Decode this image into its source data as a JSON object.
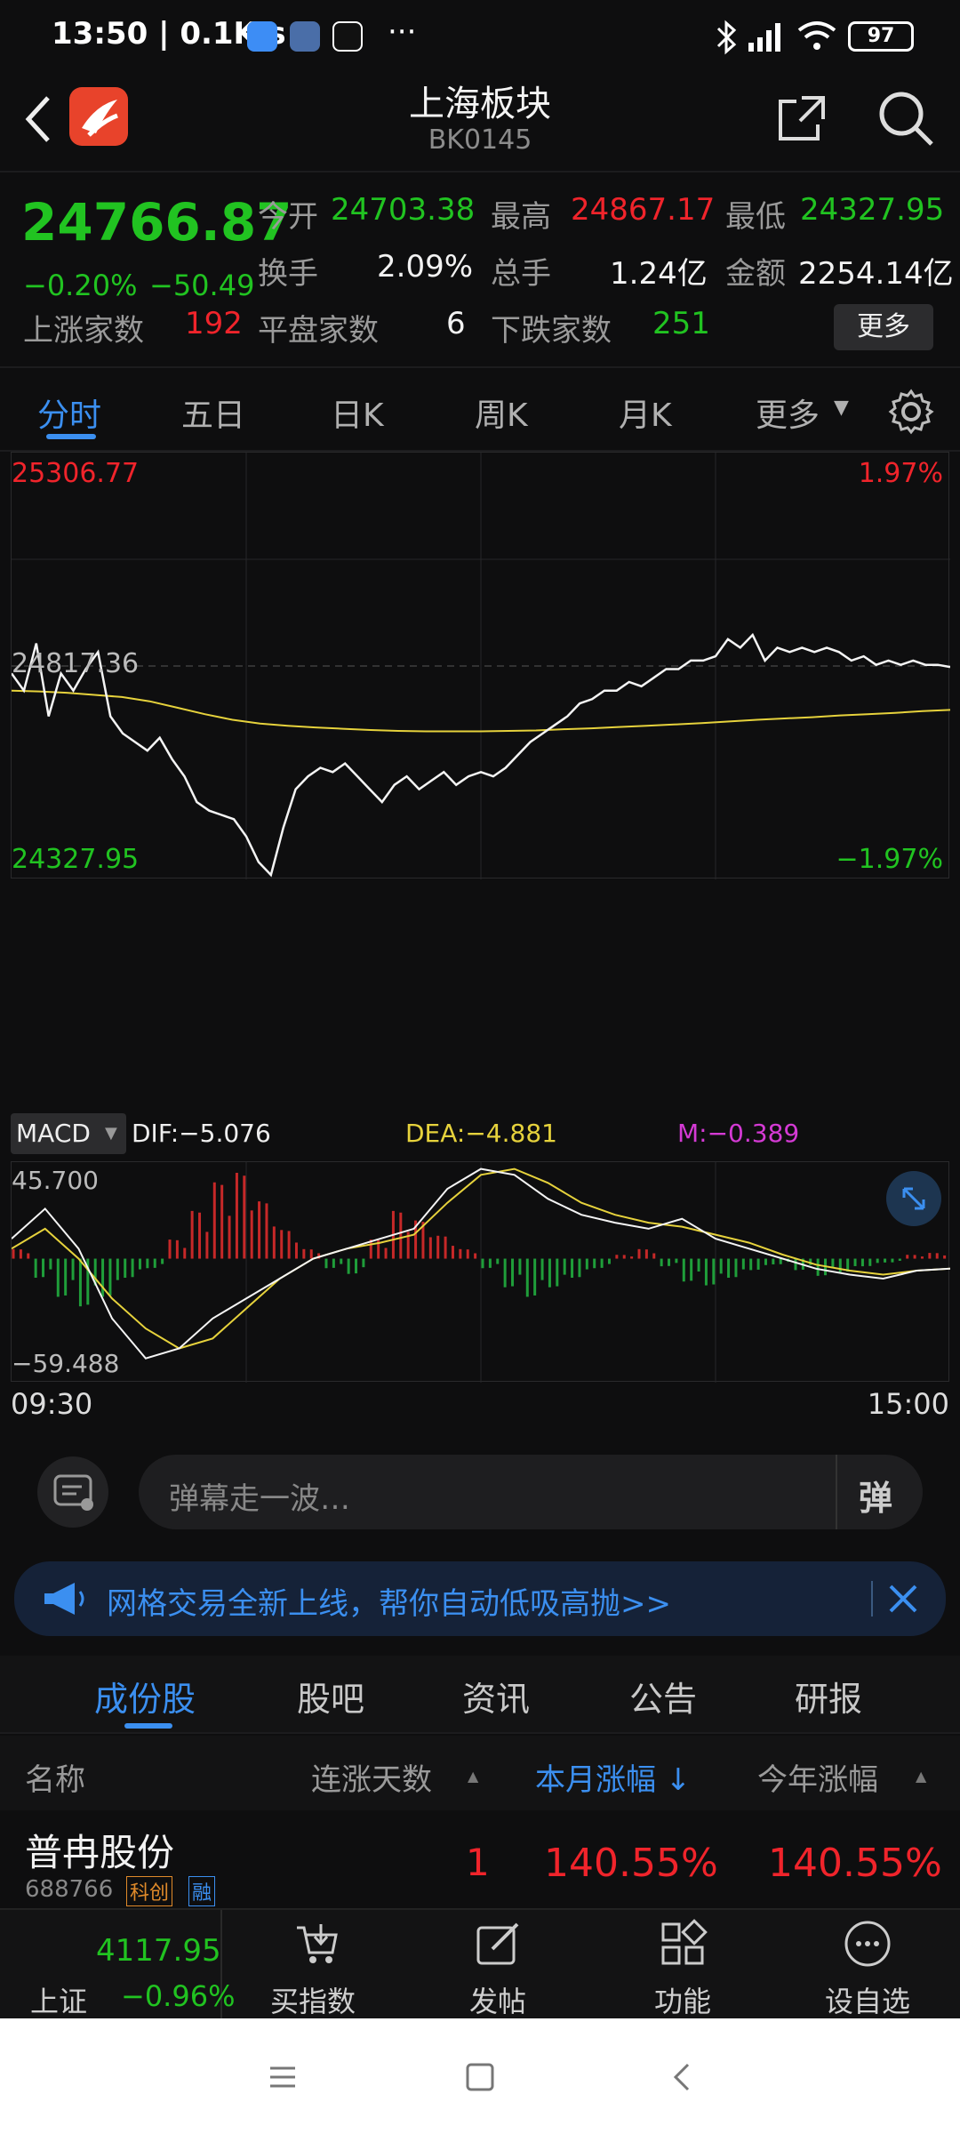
{
  "status_bar": {
    "time": "13:50 | 0.1K/s",
    "more_dots": "···",
    "battery": "97"
  },
  "header": {
    "title": "上海板块",
    "code": "BK0145"
  },
  "quote": {
    "price": "24766.87",
    "change_pct": "−0.20%",
    "change_abs": "−50.49",
    "open_label": "今开",
    "open": "24703.38",
    "high_label": "最高",
    "high": "24867.17",
    "low_label": "最低",
    "low": "24327.95",
    "turnover_label": "换手",
    "turnover": "2.09%",
    "volume_label": "总手",
    "volume": "1.24亿",
    "amount_label": "金额",
    "amount": "2254.14亿",
    "up_label": "上涨家数",
    "up": "192",
    "flat_label": "平盘家数",
    "flat": "6",
    "down_label": "下跌家数",
    "down": "251",
    "more_button": "更多"
  },
  "chart_tabs": [
    "分时",
    "五日",
    "日K",
    "周K",
    "月K",
    "更多"
  ],
  "chart_data": {
    "type": "line",
    "y_max_label": "25306.77",
    "y_max_pct": "1.97%",
    "y_mid_label": "24817.36",
    "y_min_label": "24327.95",
    "y_min_pct": "−1.97%",
    "ylim": [
      24327.95,
      25306.77
    ],
    "x_start": "09:30",
    "x_end": "15:00",
    "macd": {
      "selector": "MACD",
      "dif": "DIF:−5.076",
      "dea": "DEA:−4.881",
      "m": "M:−0.389",
      "max_label": "45.700",
      "min_label": "−59.488",
      "ylim": [
        -59.488,
        45.7
      ]
    },
    "price_series": [
      24800,
      24760,
      24870,
      24700,
      24800,
      24760,
      24810,
      24850,
      24700,
      24660,
      24640,
      24620,
      24650,
      24600,
      24560,
      24500,
      24480,
      24470,
      24460,
      24420,
      24360,
      24330,
      24440,
      24530,
      24560,
      24580,
      24570,
      24590,
      24560,
      24530,
      24500,
      24540,
      24560,
      24530,
      24550,
      24570,
      24540,
      24560,
      24570,
      24560,
      24580,
      24610,
      24640,
      24660,
      24680,
      24700,
      24730,
      24740,
      24760,
      24760,
      24780,
      24770,
      24790,
      24810,
      24810,
      24830,
      24830,
      24840,
      24880,
      24860,
      24890,
      24830,
      24860,
      24850,
      24860,
      24850,
      24860,
      24850,
      24830,
      24840,
      24820,
      24830,
      24820,
      24830,
      24820,
      24820,
      24815
    ],
    "avg_series": [
      24760,
      24758,
      24755,
      24750,
      24745,
      24735,
      24720,
      24705,
      24692,
      24683,
      24678,
      24674,
      24671,
      24668,
      24666,
      24665,
      24665,
      24665,
      24666,
      24667,
      24670,
      24672,
      24675,
      24678,
      24681,
      24684,
      24688,
      24692,
      24695,
      24698,
      24702,
      24705,
      24708,
      24712,
      24715
    ],
    "macd_hist": [
      5,
      -10,
      -20,
      -25,
      -20,
      -10,
      -5,
      10,
      25,
      40,
      45,
      30,
      15,
      5,
      -5,
      -8,
      10,
      25,
      20,
      12,
      5,
      -5,
      -15,
      -20,
      -15,
      -10,
      -5,
      2,
      5,
      -4,
      -12,
      -14,
      -10,
      -6,
      -3,
      -6,
      -9,
      -7,
      -4,
      -2,
      2,
      3
    ],
    "dif_series": [
      10,
      25,
      5,
      -30,
      -50,
      -45,
      -30,
      -20,
      -10,
      0,
      5,
      10,
      15,
      35,
      45,
      42,
      30,
      22,
      18,
      15,
      20,
      10,
      5,
      0,
      -5,
      -8,
      -10,
      -6,
      -5
    ],
    "dea_series": [
      5,
      15,
      0,
      -20,
      -35,
      -45,
      -40,
      -25,
      -10,
      0,
      5,
      8,
      12,
      28,
      42,
      45,
      38,
      28,
      22,
      18,
      16,
      12,
      8,
      2,
      -3,
      -6,
      -8,
      -6,
      -5
    ]
  },
  "comment": {
    "placeholder": "弹幕走一波…",
    "danmu_label": "弹"
  },
  "banner": {
    "text": "网格交易全新上线，帮你自动低吸高抛>>"
  },
  "list_tabs": [
    "成份股",
    "股吧",
    "资讯",
    "公告",
    "研报"
  ],
  "table": {
    "col_name": "名称",
    "col_days": "连涨天数",
    "col_month": "本月涨幅 ↓",
    "col_year": "今年涨幅",
    "rows": [
      {
        "name": "普冉股份",
        "code": "688766",
        "tag1": "科创",
        "tag2": "融",
        "days": "1",
        "month": "140.55%",
        "year": "140.55%"
      }
    ]
  },
  "toolbar": {
    "index_value": "4117.95",
    "index_name": "上证",
    "index_change": "−0.96%",
    "buy_label": "买指数",
    "post_label": "发帖",
    "func_label": "功能",
    "watch_label": "设自选"
  },
  "colors": {
    "up": "#f0242b",
    "down": "#21c321",
    "accent": "#3b8ff0",
    "avg_line": "#e6d23c"
  }
}
